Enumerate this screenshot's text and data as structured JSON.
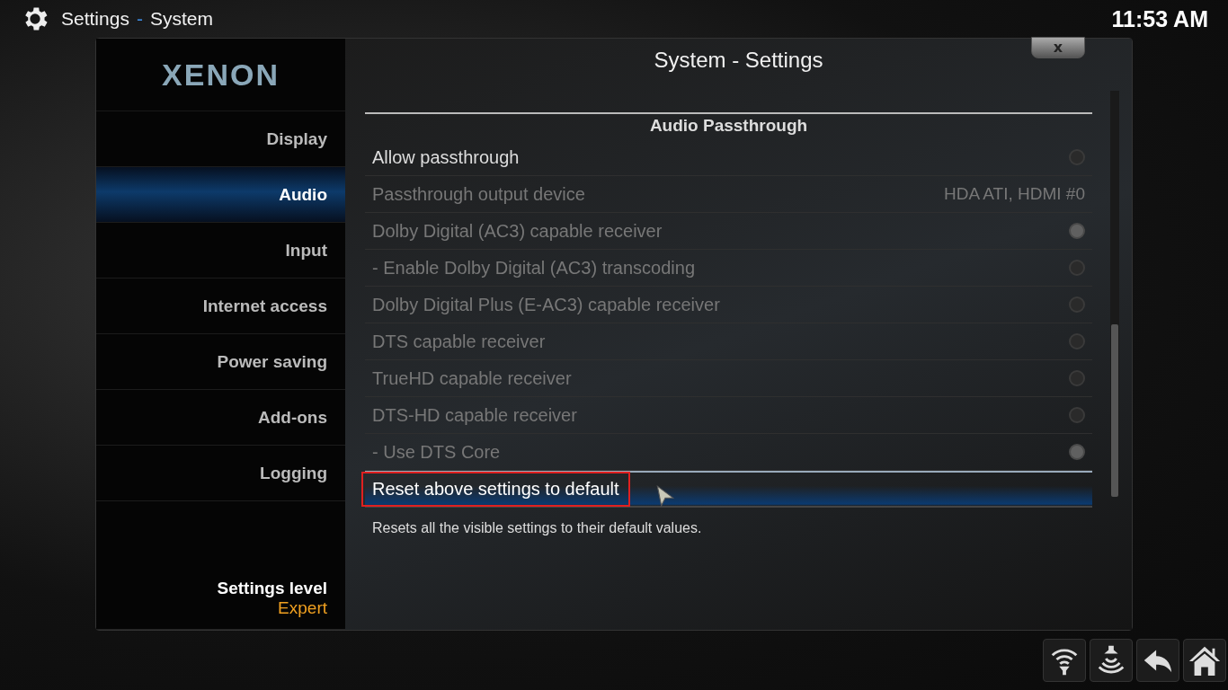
{
  "header": {
    "title": "Settings",
    "separator": "-",
    "subtitle": "System",
    "clock": "11:53 AM"
  },
  "logo": "XENON",
  "sidebar": {
    "items": [
      {
        "label": "Display",
        "selected": false
      },
      {
        "label": "Audio",
        "selected": true
      },
      {
        "label": "Input",
        "selected": false
      },
      {
        "label": "Internet access",
        "selected": false
      },
      {
        "label": "Power saving",
        "selected": false
      },
      {
        "label": "Add-ons",
        "selected": false
      },
      {
        "label": "Logging",
        "selected": false
      }
    ],
    "level_label": "Settings level",
    "level_value": "Expert"
  },
  "dialog": {
    "title": "System - Settings",
    "close": "x",
    "section": "Audio Passthrough",
    "settings": [
      {
        "kind": "toggle",
        "label": "Allow passthrough",
        "disabled": false,
        "on": false
      },
      {
        "kind": "value",
        "label": "Passthrough output device",
        "disabled": true,
        "value": "HDA ATI, HDMI #0"
      },
      {
        "kind": "toggle",
        "label": "Dolby Digital (AC3) capable receiver",
        "disabled": true,
        "on": true
      },
      {
        "kind": "toggle",
        "label": "- Enable Dolby Digital (AC3) transcoding",
        "disabled": true,
        "on": false
      },
      {
        "kind": "toggle",
        "label": "Dolby Digital Plus (E-AC3) capable receiver",
        "disabled": true,
        "on": false
      },
      {
        "kind": "toggle",
        "label": "DTS capable receiver",
        "disabled": true,
        "on": false
      },
      {
        "kind": "toggle",
        "label": "TrueHD capable receiver",
        "disabled": true,
        "on": false
      },
      {
        "kind": "toggle",
        "label": "DTS-HD capable receiver",
        "disabled": true,
        "on": false
      },
      {
        "kind": "toggle",
        "label": "- Use DTS Core",
        "disabled": true,
        "on": true
      },
      {
        "kind": "action",
        "label": "Reset above settings to default",
        "disabled": false,
        "selected": true
      }
    ],
    "description": "Resets all the visible settings to their default values."
  }
}
